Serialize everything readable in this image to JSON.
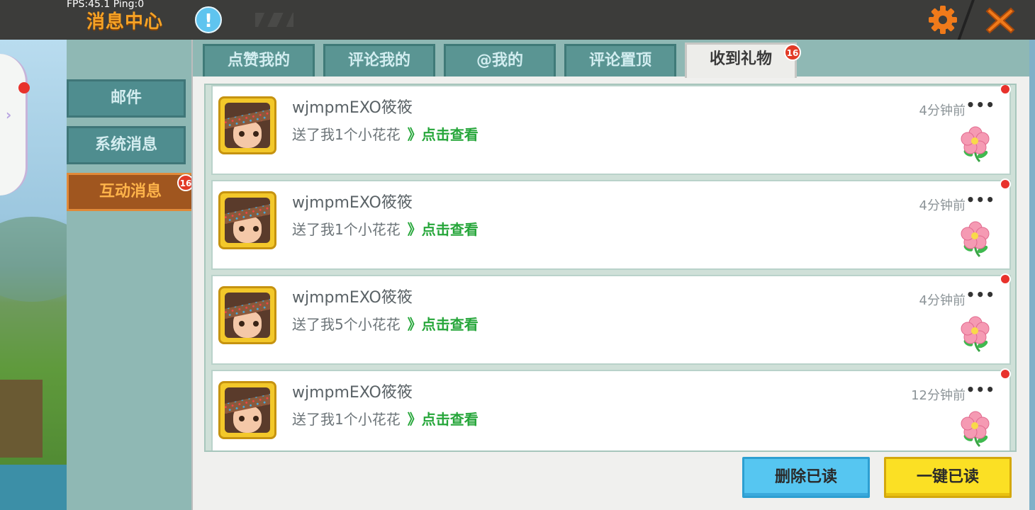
{
  "hud": {
    "fps": "FPS:45.1  Ping:0"
  },
  "header": {
    "title": "消息中心",
    "info_icon": "!"
  },
  "sidebar": {
    "items": [
      {
        "label": "邮件"
      },
      {
        "label": "系统消息"
      },
      {
        "label": "互动消息",
        "badge": "16",
        "active": true
      }
    ]
  },
  "tabs": [
    {
      "label": "点赞我的"
    },
    {
      "label": "评论我的"
    },
    {
      "label": "@我的"
    },
    {
      "label": "评论置顶"
    },
    {
      "label": "收到礼物",
      "badge": "16",
      "active": true
    }
  ],
  "messages": [
    {
      "name": "wjmpmEXO筱筱",
      "text": "送了我1个小花花",
      "link": "》点击查看",
      "time": "4分钟前",
      "more": "•••"
    },
    {
      "name": "wjmpmEXO筱筱",
      "text": "送了我1个小花花",
      "link": "》点击查看",
      "time": "4分钟前",
      "more": "•••"
    },
    {
      "name": "wjmpmEXO筱筱",
      "text": "送了我5个小花花",
      "link": "》点击查看",
      "time": "4分钟前",
      "more": "•••"
    },
    {
      "name": "wjmpmEXO筱筱",
      "text": "送了我1个小花花",
      "link": "》点击查看",
      "time": "12分钟前",
      "more": "•••"
    }
  ],
  "actions": {
    "delete_read": "删除已读",
    "mark_all_read": "一键已读"
  },
  "colors": {
    "accent": "#f5a225",
    "link": "#26a63a",
    "badge": "#e23a26",
    "tab": "#5a9593"
  }
}
